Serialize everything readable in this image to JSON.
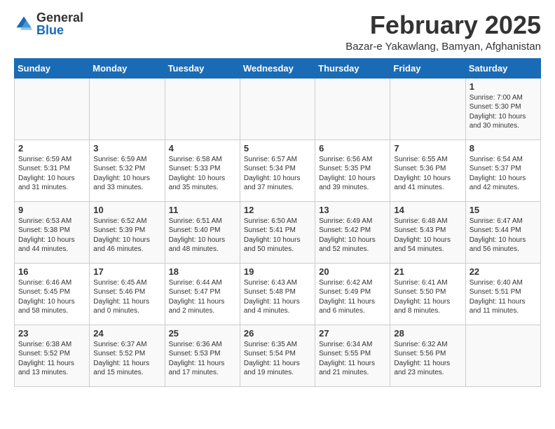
{
  "logo": {
    "general": "General",
    "blue": "Blue"
  },
  "header": {
    "month": "February 2025",
    "location": "Bazar-e Yakawlang, Bamyan, Afghanistan"
  },
  "weekdays": [
    "Sunday",
    "Monday",
    "Tuesday",
    "Wednesday",
    "Thursday",
    "Friday",
    "Saturday"
  ],
  "weeks": [
    [
      {
        "day": "",
        "info": ""
      },
      {
        "day": "",
        "info": ""
      },
      {
        "day": "",
        "info": ""
      },
      {
        "day": "",
        "info": ""
      },
      {
        "day": "",
        "info": ""
      },
      {
        "day": "",
        "info": ""
      },
      {
        "day": "1",
        "info": "Sunrise: 7:00 AM\nSunset: 5:30 PM\nDaylight: 10 hours\nand 30 minutes."
      }
    ],
    [
      {
        "day": "2",
        "info": "Sunrise: 6:59 AM\nSunset: 5:31 PM\nDaylight: 10 hours\nand 31 minutes."
      },
      {
        "day": "3",
        "info": "Sunrise: 6:59 AM\nSunset: 5:32 PM\nDaylight: 10 hours\nand 33 minutes."
      },
      {
        "day": "4",
        "info": "Sunrise: 6:58 AM\nSunset: 5:33 PM\nDaylight: 10 hours\nand 35 minutes."
      },
      {
        "day": "5",
        "info": "Sunrise: 6:57 AM\nSunset: 5:34 PM\nDaylight: 10 hours\nand 37 minutes."
      },
      {
        "day": "6",
        "info": "Sunrise: 6:56 AM\nSunset: 5:35 PM\nDaylight: 10 hours\nand 39 minutes."
      },
      {
        "day": "7",
        "info": "Sunrise: 6:55 AM\nSunset: 5:36 PM\nDaylight: 10 hours\nand 41 minutes."
      },
      {
        "day": "8",
        "info": "Sunrise: 6:54 AM\nSunset: 5:37 PM\nDaylight: 10 hours\nand 42 minutes."
      }
    ],
    [
      {
        "day": "9",
        "info": "Sunrise: 6:53 AM\nSunset: 5:38 PM\nDaylight: 10 hours\nand 44 minutes."
      },
      {
        "day": "10",
        "info": "Sunrise: 6:52 AM\nSunset: 5:39 PM\nDaylight: 10 hours\nand 46 minutes."
      },
      {
        "day": "11",
        "info": "Sunrise: 6:51 AM\nSunset: 5:40 PM\nDaylight: 10 hours\nand 48 minutes."
      },
      {
        "day": "12",
        "info": "Sunrise: 6:50 AM\nSunset: 5:41 PM\nDaylight: 10 hours\nand 50 minutes."
      },
      {
        "day": "13",
        "info": "Sunrise: 6:49 AM\nSunset: 5:42 PM\nDaylight: 10 hours\nand 52 minutes."
      },
      {
        "day": "14",
        "info": "Sunrise: 6:48 AM\nSunset: 5:43 PM\nDaylight: 10 hours\nand 54 minutes."
      },
      {
        "day": "15",
        "info": "Sunrise: 6:47 AM\nSunset: 5:44 PM\nDaylight: 10 hours\nand 56 minutes."
      }
    ],
    [
      {
        "day": "16",
        "info": "Sunrise: 6:46 AM\nSunset: 5:45 PM\nDaylight: 10 hours\nand 58 minutes."
      },
      {
        "day": "17",
        "info": "Sunrise: 6:45 AM\nSunset: 5:46 PM\nDaylight: 11 hours\nand 0 minutes."
      },
      {
        "day": "18",
        "info": "Sunrise: 6:44 AM\nSunset: 5:47 PM\nDaylight: 11 hours\nand 2 minutes."
      },
      {
        "day": "19",
        "info": "Sunrise: 6:43 AM\nSunset: 5:48 PM\nDaylight: 11 hours\nand 4 minutes."
      },
      {
        "day": "20",
        "info": "Sunrise: 6:42 AM\nSunset: 5:49 PM\nDaylight: 11 hours\nand 6 minutes."
      },
      {
        "day": "21",
        "info": "Sunrise: 6:41 AM\nSunset: 5:50 PM\nDaylight: 11 hours\nand 8 minutes."
      },
      {
        "day": "22",
        "info": "Sunrise: 6:40 AM\nSunset: 5:51 PM\nDaylight: 11 hours\nand 11 minutes."
      }
    ],
    [
      {
        "day": "23",
        "info": "Sunrise: 6:38 AM\nSunset: 5:52 PM\nDaylight: 11 hours\nand 13 minutes."
      },
      {
        "day": "24",
        "info": "Sunrise: 6:37 AM\nSunset: 5:52 PM\nDaylight: 11 hours\nand 15 minutes."
      },
      {
        "day": "25",
        "info": "Sunrise: 6:36 AM\nSunset: 5:53 PM\nDaylight: 11 hours\nand 17 minutes."
      },
      {
        "day": "26",
        "info": "Sunrise: 6:35 AM\nSunset: 5:54 PM\nDaylight: 11 hours\nand 19 minutes."
      },
      {
        "day": "27",
        "info": "Sunrise: 6:34 AM\nSunset: 5:55 PM\nDaylight: 11 hours\nand 21 minutes."
      },
      {
        "day": "28",
        "info": "Sunrise: 6:32 AM\nSunset: 5:56 PM\nDaylight: 11 hours\nand 23 minutes."
      },
      {
        "day": "",
        "info": ""
      }
    ]
  ]
}
